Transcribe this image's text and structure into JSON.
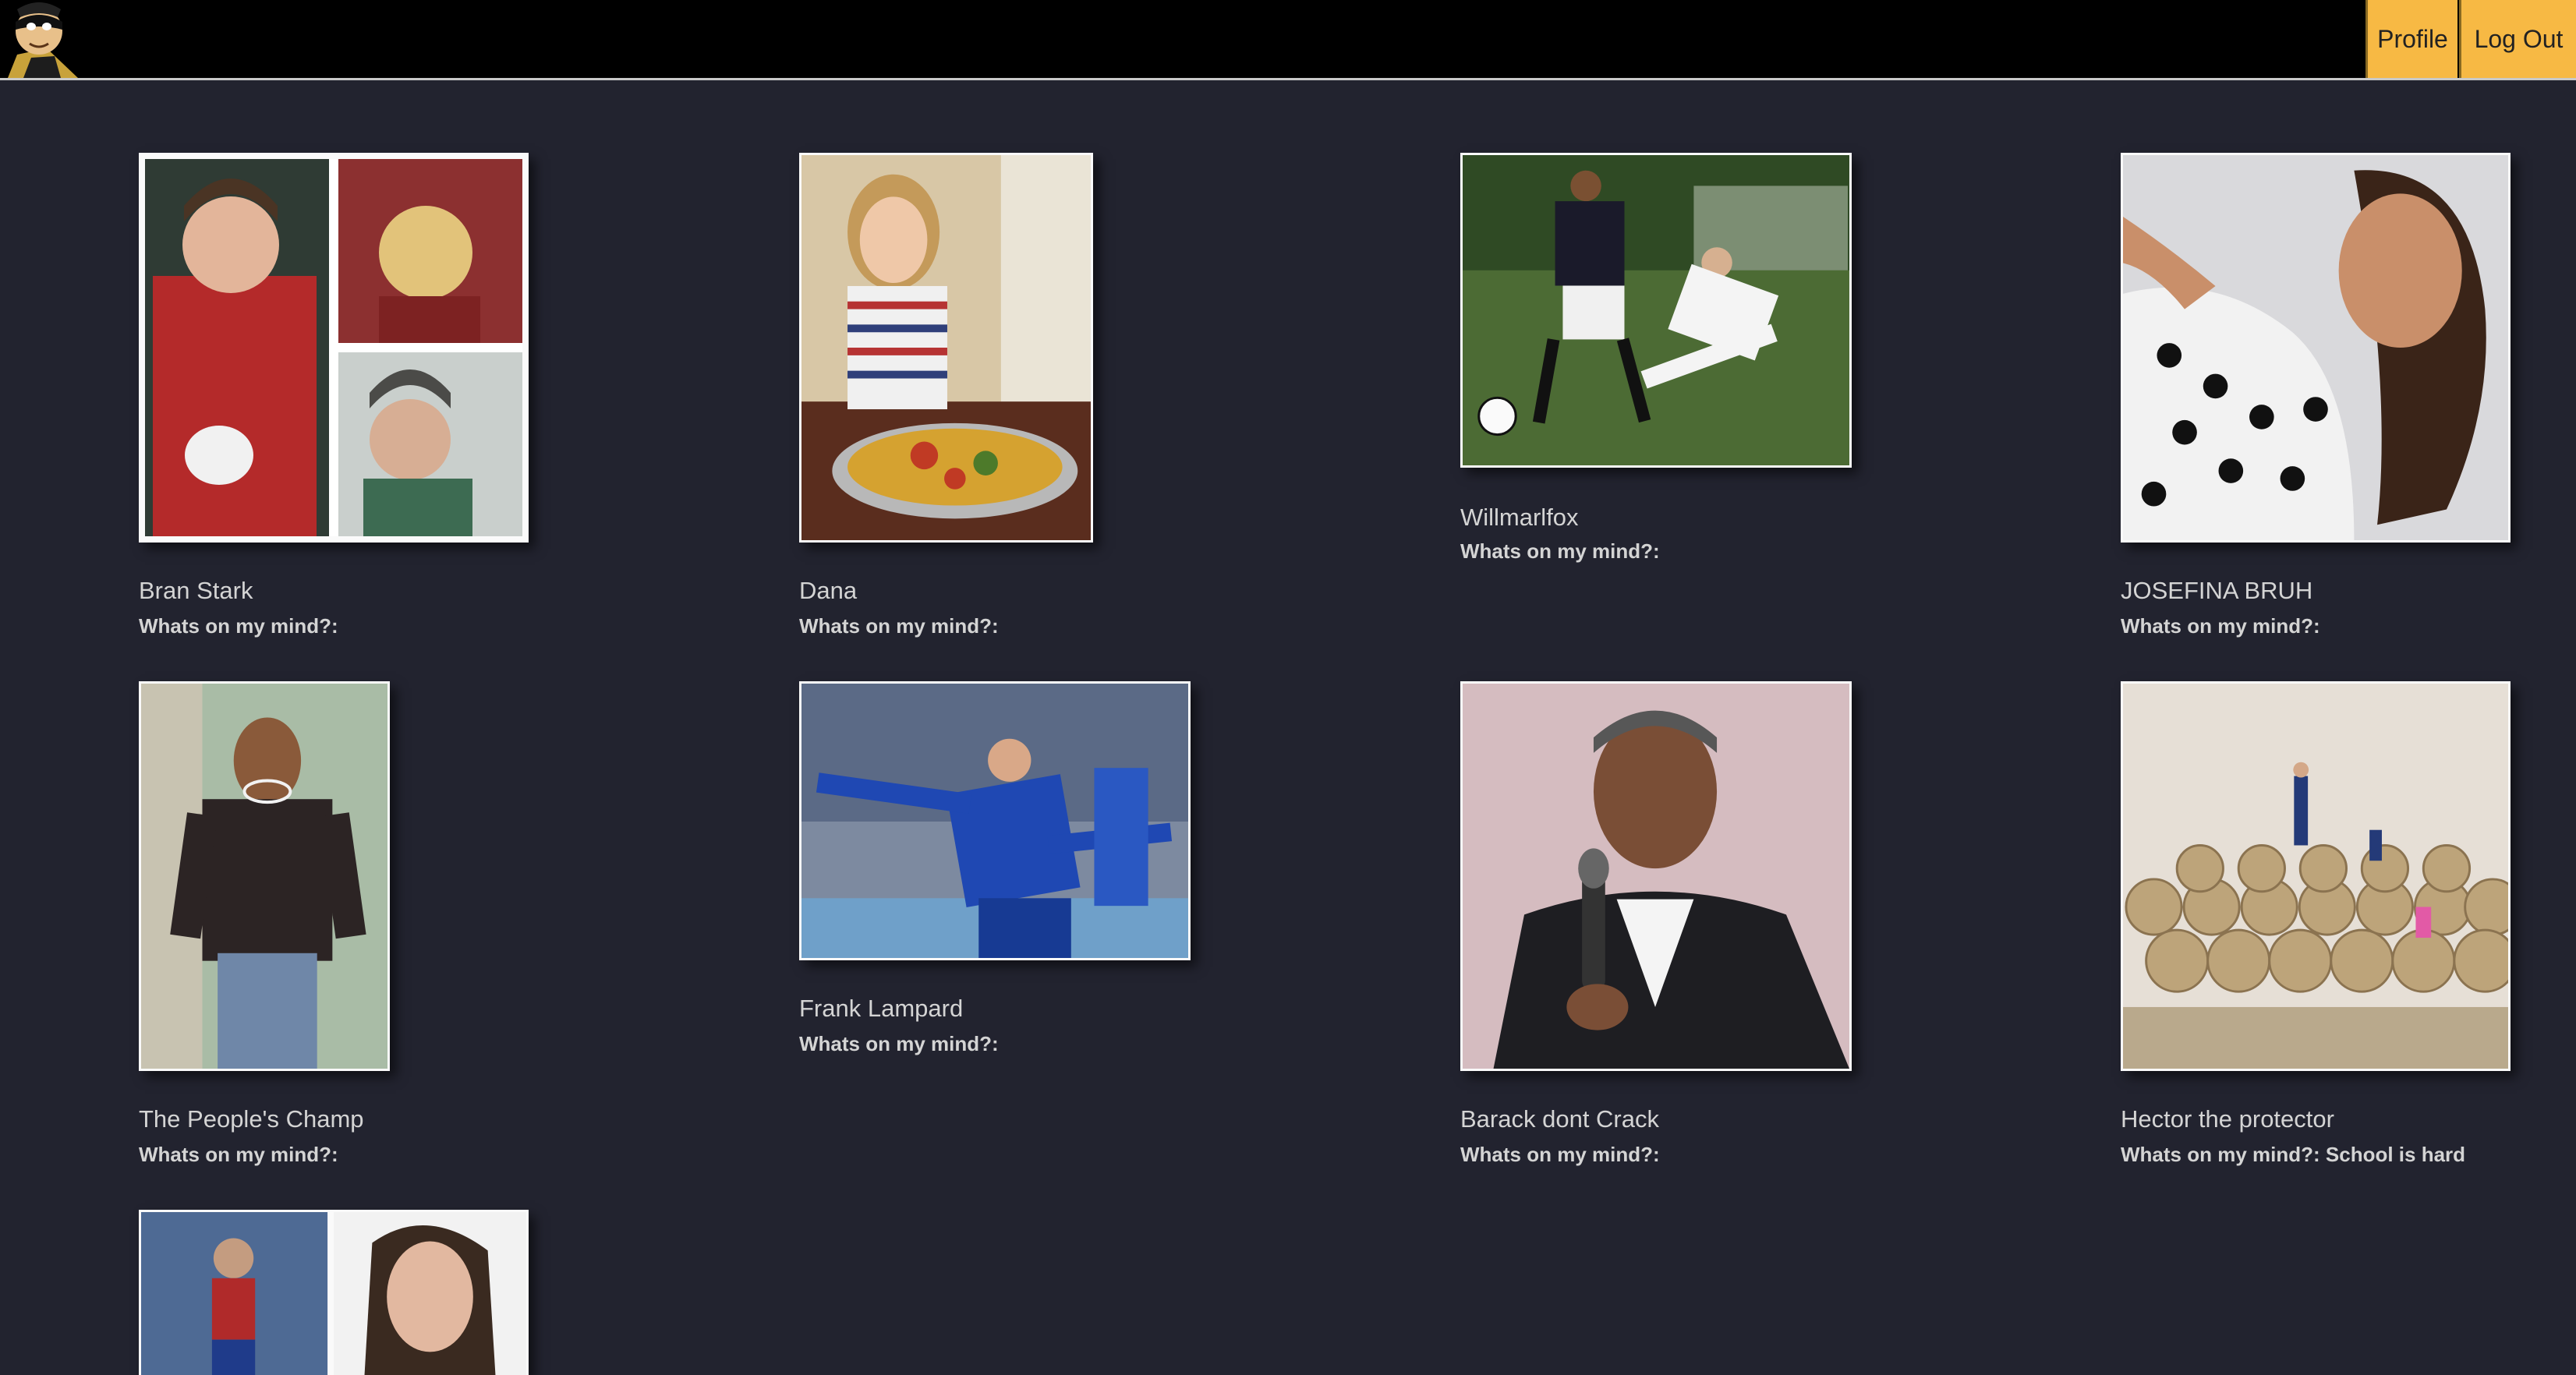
{
  "nav": {
    "profile_label": "Profile",
    "logout_label": "Log Out"
  },
  "mind_prefix": "Whats on my mind?:",
  "users": [
    {
      "name": "Bran Stark",
      "status": ""
    },
    {
      "name": "Dana",
      "status": ""
    },
    {
      "name": "Willmarlfox",
      "status": ""
    },
    {
      "name": "JOSEFINA BRUH",
      "status": ""
    },
    {
      "name": "The People's Champ",
      "status": ""
    },
    {
      "name": "Frank Lampard",
      "status": ""
    },
    {
      "name": "Barack dont Crack",
      "status": ""
    },
    {
      "name": "Hector the protector",
      "status": "School is hard"
    }
  ],
  "colors": {
    "background": "#22232f",
    "navbar": "#000000",
    "accent": "#f7b944",
    "text": "#d4d4d4"
  }
}
